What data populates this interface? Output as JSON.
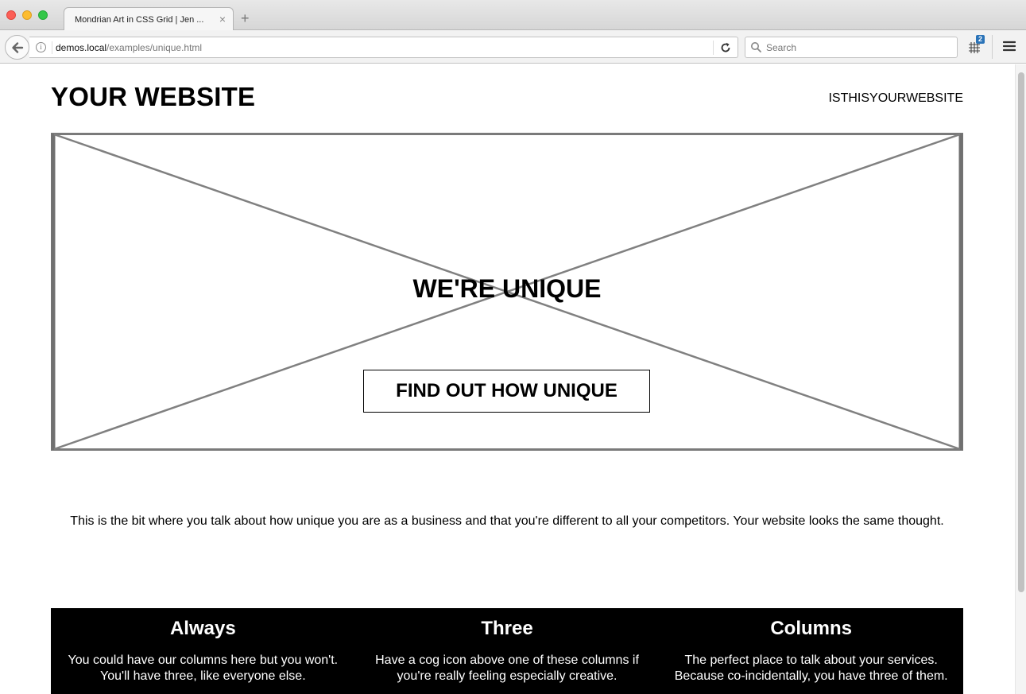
{
  "browser": {
    "tab_title": "Mondrian Art in CSS Grid | Jen ...",
    "url_host": "demos.local",
    "url_path": "/examples/unique.html",
    "search_placeholder": "Search",
    "extension_badge": "2"
  },
  "site": {
    "title": "YOUR WEBSITE",
    "nav_link": "ISTHISYOURWEBSITE"
  },
  "hero": {
    "heading": "WE'RE UNIQUE",
    "button_label": "FIND OUT HOW UNIQUE"
  },
  "intro": {
    "text": "This is the bit where you talk about how unique you are as a business and that you're different to all your competitors. Your website looks the same thought."
  },
  "columns": [
    {
      "title": "Always",
      "text": "You could have our columns here but you won't. You'll have three, like everyone else."
    },
    {
      "title": "Three",
      "text": "Have a cog icon above one of these columns if you're really feeling especially creative."
    },
    {
      "title": "Columns",
      "text": "The perfect place to talk about your services. Because co-incidentally, you have three of them."
    }
  ],
  "colors": {
    "columns_background": "#000000",
    "placeholder_lines": "#808080"
  }
}
